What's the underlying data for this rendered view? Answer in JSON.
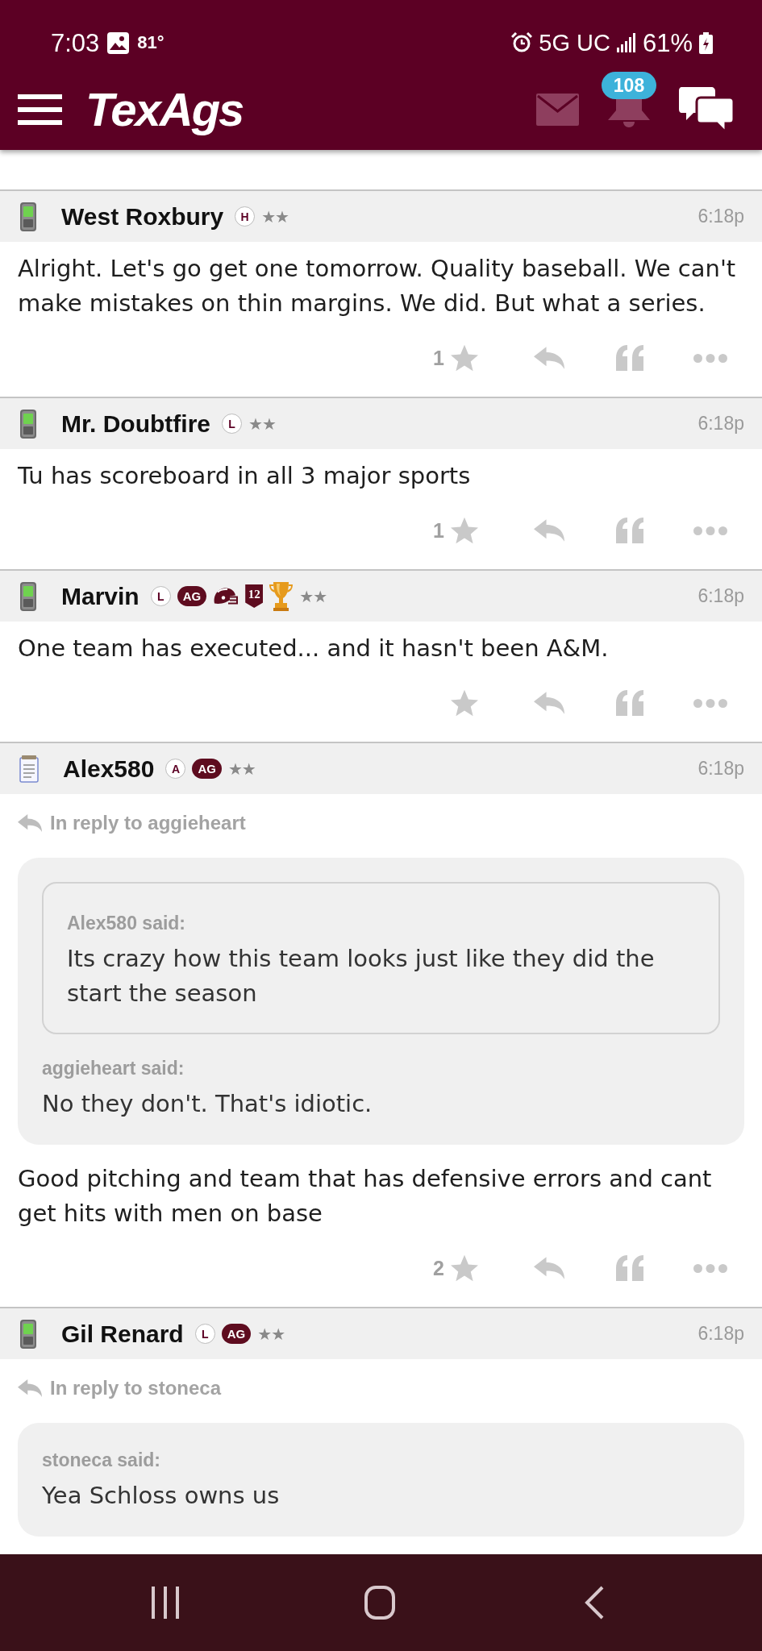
{
  "status_bar": {
    "time": "7:03",
    "temperature": "81°",
    "network": "5G UC",
    "battery": "61%"
  },
  "app_bar": {
    "logo": "TexAgs",
    "notification_count": "108"
  },
  "posts": [
    {
      "author": "West Roxbury",
      "device": {
        "kind": "phone"
      },
      "badges": [
        {
          "kind": "letter",
          "text": "H"
        }
      ],
      "rank": "★★",
      "time": "6:18p",
      "body": "Alright. Let's go get one tomorrow. Quality baseball. We can't make mistakes on thin margins. We did. But what a series.",
      "actions": [
        {
          "kind": "star",
          "count": "1"
        },
        {
          "kind": "reply"
        },
        {
          "kind": "quote"
        },
        {
          "kind": "more"
        }
      ]
    },
    {
      "author": "Mr. Doubtfire",
      "device": {
        "kind": "phone"
      },
      "badges": [
        {
          "kind": "letter",
          "text": "L"
        }
      ],
      "rank": "★★",
      "time": "6:18p",
      "body": "Tu has scoreboard in all 3 major sports",
      "actions": [
        {
          "kind": "star",
          "count": "1"
        },
        {
          "kind": "reply"
        },
        {
          "kind": "quote"
        },
        {
          "kind": "more"
        }
      ]
    },
    {
      "author": "Marvin",
      "device": {
        "kind": "phone"
      },
      "badges": [
        {
          "kind": "letter",
          "text": "L"
        },
        {
          "kind": "pill",
          "text": "AG"
        },
        {
          "kind": "helmet"
        },
        {
          "kind": "shield",
          "text": "12"
        },
        {
          "kind": "trophy"
        }
      ],
      "rank": "★★",
      "time": "6:18p",
      "body": "One team has executed... and it hasn't been A&M.",
      "actions": [
        {
          "kind": "star"
        },
        {
          "kind": "reply"
        },
        {
          "kind": "quote"
        },
        {
          "kind": "more"
        }
      ]
    },
    {
      "author": "Alex580",
      "device": {
        "kind": "notepad"
      },
      "badges": [
        {
          "kind": "letter",
          "text": "A"
        },
        {
          "kind": "pill",
          "text": "AG"
        }
      ],
      "rank": "★★",
      "time": "6:18p",
      "reply_to": "In reply to aggieheart",
      "quote": {
        "nested": {
          "said": "Alex580 said:",
          "text": "Its crazy how this team looks just like they did the start the season"
        },
        "said": "aggieheart said:",
        "text": "No they don't. That's idiotic."
      },
      "body": "Good pitching and team that has defensive errors and cant get hits with men on base",
      "actions": [
        {
          "kind": "star",
          "count": "2"
        },
        {
          "kind": "reply"
        },
        {
          "kind": "quote"
        },
        {
          "kind": "more"
        }
      ]
    },
    {
      "author": "Gil Renard",
      "device": {
        "kind": "phone"
      },
      "badges": [
        {
          "kind": "letter",
          "text": "L"
        },
        {
          "kind": "pill",
          "text": "AG"
        }
      ],
      "rank": "★★",
      "time": "6:18p",
      "reply_to": "In reply to stoneca",
      "quote": {
        "said": "stoneca said:",
        "text": "Yea Schloss owns us"
      }
    }
  ]
}
